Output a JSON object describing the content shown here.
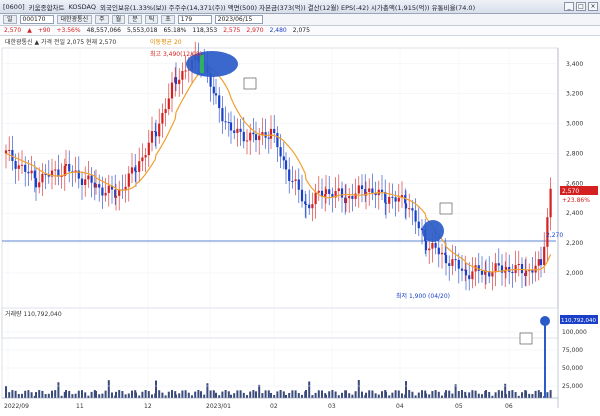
{
  "titlebar": {
    "code": "[0600]",
    "title": "키움종합차트",
    "market": "KOSDAQ",
    "info": "외국인보유(1.33%(보)) 주주수(14,371(주)) 액면(500) 자본금(373(억)) 결산(12월) EPS(-42) 시가총액(1,915(억)) 유통비율(74.0)",
    "ctrl_min": "_",
    "ctrl_max": "□",
    "ctrl_close": "×"
  },
  "toolbar": {
    "period_label": "일",
    "code_value": "000170",
    "stock_name": "대한광통신",
    "count_value": "179",
    "date_value": "2023/06/15",
    "buttons": [
      "주",
      "월",
      "분",
      "틱",
      "초"
    ]
  },
  "pricebar": {
    "price": "2,570",
    "change": "▲",
    "change_val": "+90",
    "rate": "+3.56%",
    "volume": "48,557,066",
    "amount": "5,553,018",
    "ratio": "65.18%",
    "trade_val": "118,353",
    "open": "2,575",
    "high": "2,970",
    "low": "2,480",
    "prev": "2,075"
  },
  "legend": {
    "text": "대한광통신 ▲ 가격 전일 2,075 현재 2,570",
    "ma_text": "이동평균 20"
  },
  "volume_legend": "거래량 110,792,040",
  "price_axis": [
    "3,400",
    "3,200",
    "3,000",
    "2,800",
    "2,600",
    "2,400",
    "2,200",
    "2,000"
  ],
  "volume_axis": [
    "100,000",
    "75,000",
    "50,000",
    "25,000"
  ],
  "x_axis": [
    "2022/09",
    "11",
    "12",
    "2023/01",
    "02",
    "03",
    "04",
    "05",
    "06"
  ],
  "annotations": {
    "peak": "최고 3,490(12/08)",
    "low": "최저 1,900 (04/20)",
    "ref_price": "2,270",
    "cur_price": "2,570",
    "cur_change": "+23.86%",
    "cur_volume": "110,792,040"
  },
  "colors": {
    "up": "#d42020",
    "down": "#1a40c8",
    "ma": "#f0a030",
    "highlight": "#2a5bc8"
  }
}
